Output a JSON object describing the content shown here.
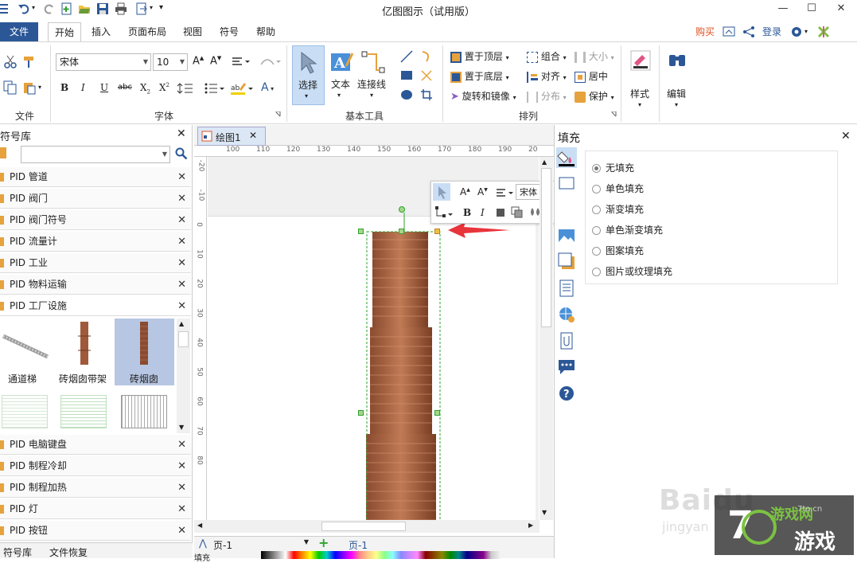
{
  "app": {
    "title": "亿图图示（试用版）"
  },
  "window": {
    "minimize": "—",
    "maximize": "☐",
    "close": "✕"
  },
  "menu": {
    "file": "文件",
    "tabs": [
      "开始",
      "插入",
      "页面布局",
      "视图",
      "符号",
      "帮助"
    ],
    "buy": "购买",
    "login": "登录"
  },
  "ribbon": {
    "groups": {
      "file": "文件",
      "font": "字体",
      "basic_tools": "基本工具",
      "arrange": "排列"
    },
    "font_name": "宋体",
    "font_size": "10",
    "bold": "B",
    "italic": "I",
    "underline": "U",
    "strike": "abc",
    "select": "选择",
    "text": "文本",
    "connector": "连接线",
    "bring_front": "置于顶层",
    "send_back": "置于底层",
    "rotate_mirror": "旋转和镜像",
    "group": "组合",
    "align": "对齐",
    "distribute": "分布",
    "size": "大小",
    "center": "居中",
    "protect": "保护",
    "style": "样式",
    "edit": "编辑"
  },
  "library": {
    "title": "符号库",
    "items_top": [
      "PID 管道",
      "PID 阀门",
      "PID 阀门符号",
      "PID 流量计",
      "PID 工业",
      "PID 物料运输",
      "PID 工厂设施"
    ],
    "shapes": [
      "通道梯",
      "砖烟囱带架",
      "砖烟囱"
    ],
    "items_bottom": [
      "PID 电脑键盘",
      "PID 制程冷却",
      "PID 制程加热",
      "PID 灯",
      "PID 按钮"
    ],
    "tabs": [
      "符号库",
      "文件恢复"
    ]
  },
  "document": {
    "tab": "绘图1",
    "ruler_h": [
      "100",
      "110",
      "120",
      "130",
      "140",
      "150",
      "160",
      "170",
      "180",
      "190",
      "20"
    ],
    "ruler_v": [
      "-20",
      "-10",
      "0",
      "10",
      "20",
      "30",
      "40",
      "50",
      "60",
      "70",
      "80"
    ]
  },
  "floatbar": {
    "font_partial": "宋体",
    "bold": "B",
    "italic": "I"
  },
  "status": {
    "page_select": "页-1",
    "page_tab": "页-1",
    "fill_label": "填充"
  },
  "fill_panel": {
    "title": "填充",
    "options": [
      "无填充",
      "单色填充",
      "渐变填充",
      "单色渐变填充",
      "图案填充",
      "图片或纹理填充"
    ],
    "selected": "无填充"
  },
  "watermark": {
    "baidu": "Baidu",
    "jingyan": "jingyan",
    "site": "游戏网",
    "site2": "游戏",
    "url": "7to.cn"
  },
  "colors": {
    "accent": "#2b5797",
    "chimney": "#a0593a",
    "selection": "#2fa32f",
    "arrow": "#e8343b"
  }
}
